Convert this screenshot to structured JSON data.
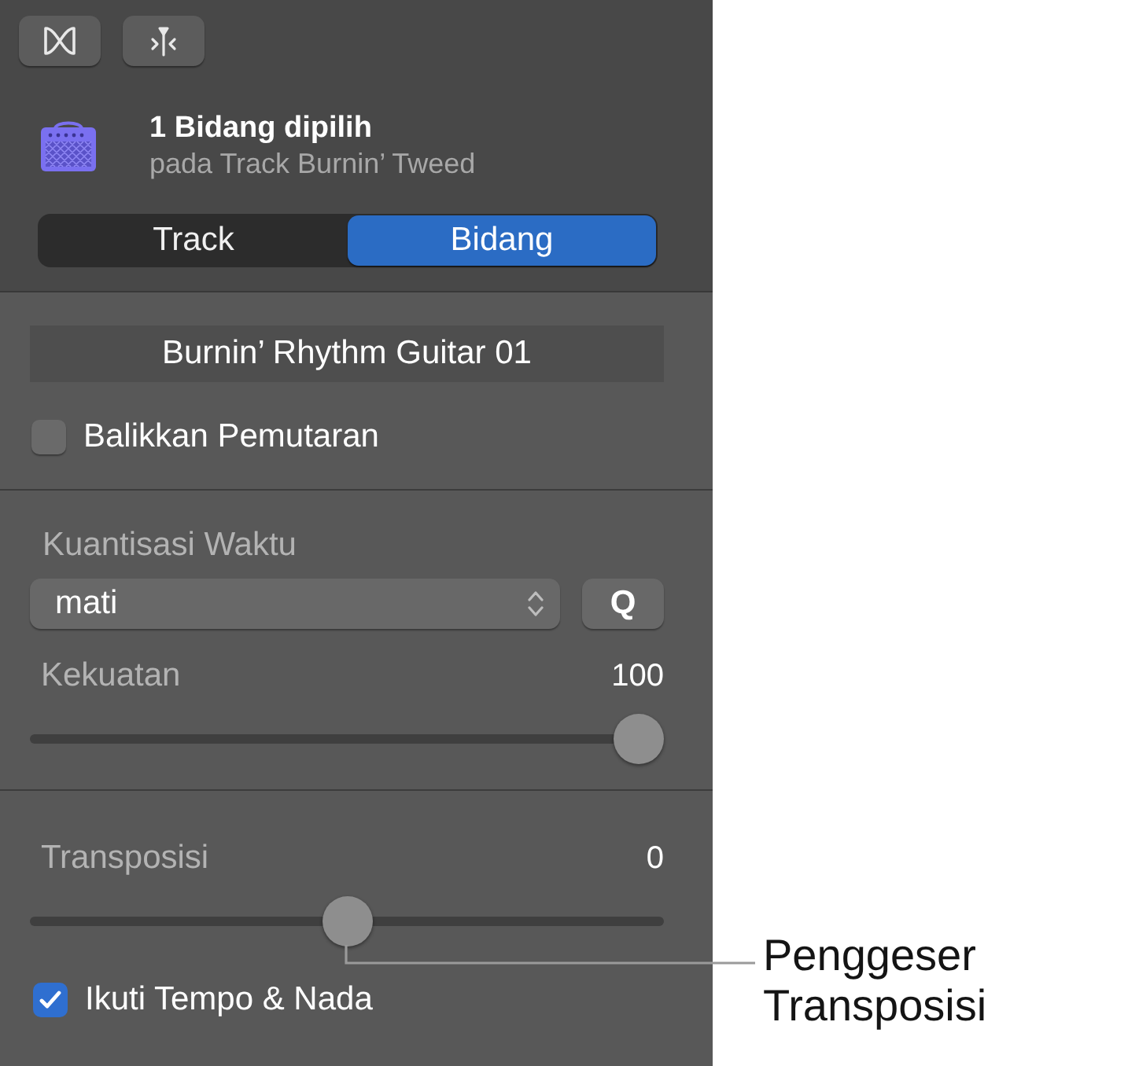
{
  "header": {
    "title": "1 Bidang dipilih",
    "subtitle": "pada Track Burnin’ Tweed"
  },
  "tabs": [
    {
      "label": "Track",
      "selected": false
    },
    {
      "label": "Bidang",
      "selected": true
    }
  ],
  "region": {
    "name": "Burnin’ Rhythm Guitar 01",
    "reverse_playback": {
      "label": "Balikkan Pemutaran",
      "checked": false
    }
  },
  "quantize": {
    "label": "Kuantisasi Waktu",
    "value": "mati",
    "button": "Q",
    "strength": {
      "label": "Kekuatan",
      "reading": "100",
      "level": 1
    }
  },
  "transpose": {
    "label": "Transposisi",
    "reading": "0",
    "level": 0.5,
    "follow": {
      "label": "Ikuti Tempo & Nada",
      "checked": true
    }
  },
  "callout": {
    "text": "Penggeser Transposisi"
  }
}
